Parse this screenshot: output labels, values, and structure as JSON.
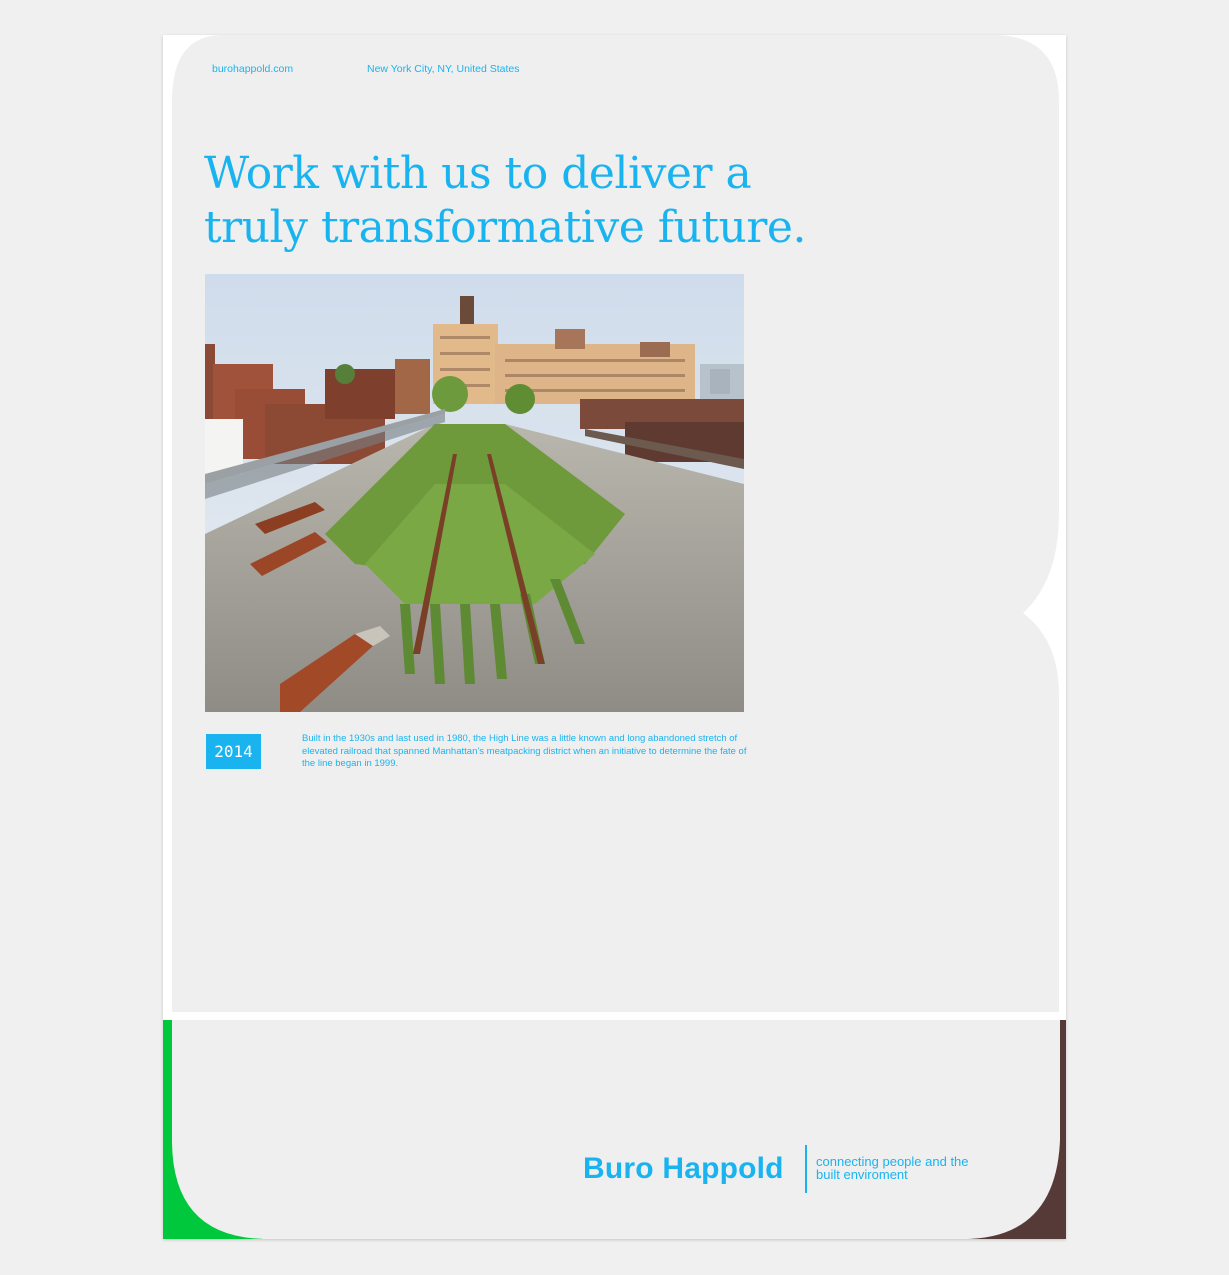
{
  "header": {
    "website": "burohappold.com",
    "location": "New York City, NY, United States"
  },
  "headline": "Work with us to deliver a truly transformative future.",
  "photo": {
    "subject": "High Line elevated park"
  },
  "project": {
    "year": "2014",
    "caption": "Built in the 1930s and last used in 1980, the High Line was a little known and long abandoned stretch of elevated railroad that spanned Manhattan’s meatpacking district when an initiative to determine the fate of the line began in 1999."
  },
  "brand": {
    "name": "Buro Happold",
    "tagline": "connecting people and the built enviroment"
  },
  "colors": {
    "accent_blue": "#19b4f0",
    "panel_gray": "#efefef",
    "accent_green": "#00c83c",
    "accent_brown": "#563a37"
  }
}
